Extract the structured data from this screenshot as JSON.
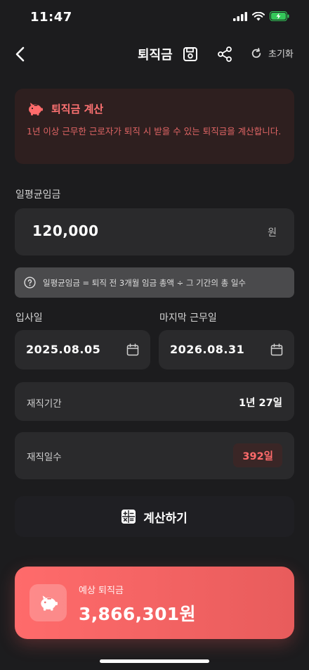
{
  "status_bar": {
    "time": "11:47"
  },
  "header": {
    "title": "퇴직금",
    "reset_label": "초기화"
  },
  "info": {
    "title": "퇴직금 계산",
    "description": "1년 이상 근무한 근로자가 퇴직 시 받을 수 있는 퇴직금을 계산합니다."
  },
  "daily_wage": {
    "label": "일평균임금",
    "value": "120,000",
    "unit": "원"
  },
  "hint": {
    "text": "일평균임금 = 퇴직 전 3개월 임금 총액 ÷ 그 기간의 총 일수"
  },
  "dates": {
    "start_label": "입사일",
    "start_value": "2025.08.05",
    "end_label": "마지막 근무일",
    "end_value": "2026.08.31"
  },
  "tenure": {
    "label": "재직기간",
    "value": "1년 27일"
  },
  "days": {
    "label": "재직일수",
    "value": "392일"
  },
  "calculate_button": {
    "label": "계산하기"
  },
  "result": {
    "label": "예상 퇴직금",
    "value": "3,866,301원"
  },
  "colors": {
    "accent": "#ff6b6b",
    "background": "#1c1c1e",
    "card": "#2a2a2c",
    "info_bg": "#2e1f1f"
  },
  "icons": [
    "back-icon",
    "save-icon",
    "share-icon",
    "refresh-icon",
    "piggy-bank-icon",
    "help-circle-icon",
    "calendar-icon",
    "calculator-icon"
  ]
}
